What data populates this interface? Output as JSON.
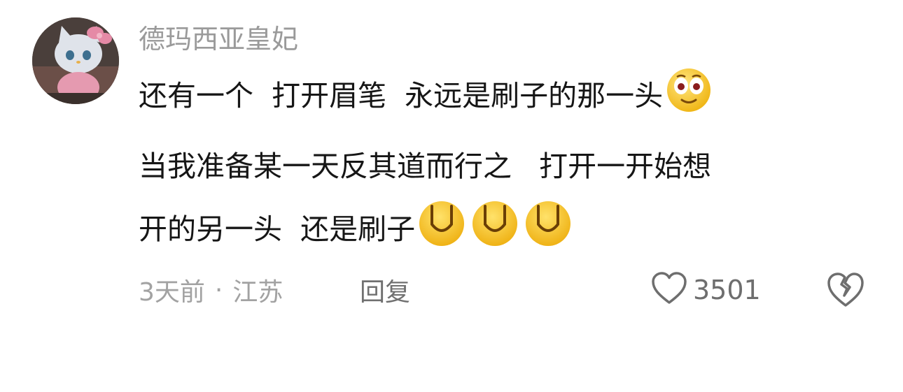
{
  "comment": {
    "username": "德玛西亚皇妃",
    "lines": [
      "还有一个  打开眉笔  永远是刷子的那一头",
      "当我准备某一天反其道而行之   打开一开始想",
      "开的另一头  还是刷子"
    ],
    "emojis": {
      "line1": "googly-eyes-smile-emoji",
      "line3": [
        "grin-emoji",
        "grin-emoji",
        "grin-emoji"
      ]
    },
    "time": "3天前",
    "separator": "·",
    "location": "江苏",
    "reply_label": "回复",
    "likes": "3501",
    "icons": {
      "like": "heart-outline-icon",
      "dislike": "broken-heart-icon"
    }
  },
  "colors": {
    "username": "#9a9a9a",
    "text": "#161616",
    "meta": "#a2a2a2",
    "emoji_yellow": "#f7c325"
  }
}
